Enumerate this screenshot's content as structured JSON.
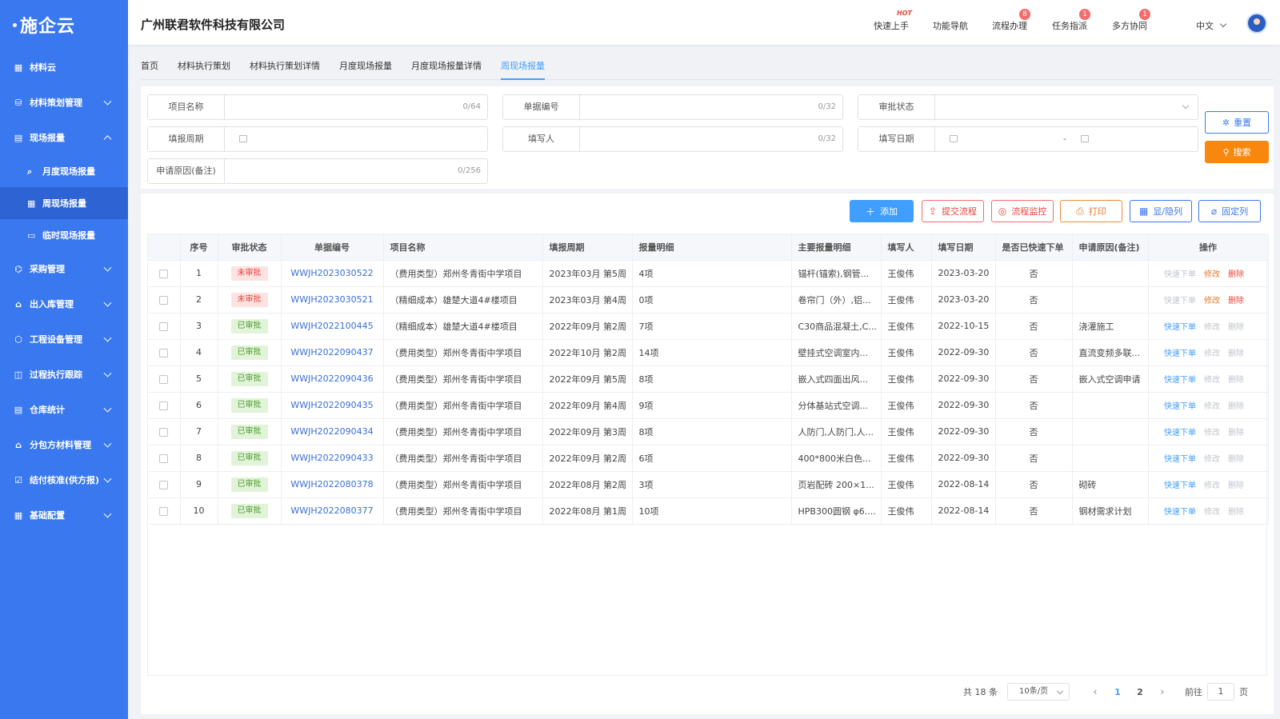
{
  "sidebar": {
    "logo": "施企云",
    "items": [
      {
        "label": "材料云",
        "icon": "grid-icon",
        "expandable": false
      },
      {
        "label": "材料策划管理",
        "icon": "database-icon",
        "expandable": true
      },
      {
        "label": "现场报量",
        "icon": "report-icon",
        "expandable": true,
        "expanded": true,
        "children": [
          {
            "label": "月度现场报量",
            "icon": "doc-search-icon"
          },
          {
            "label": "周现场报量",
            "icon": "calendar-icon",
            "active": true
          },
          {
            "label": "临时现场报量",
            "icon": "id-card-icon"
          }
        ]
      },
      {
        "label": "采购管理",
        "icon": "network-icon",
        "expandable": true
      },
      {
        "label": "出入库管理",
        "icon": "home-icon",
        "expandable": true
      },
      {
        "label": "工程设备管理",
        "icon": "cube-icon",
        "expandable": true
      },
      {
        "label": "过程执行跟踪",
        "icon": "track-icon",
        "expandable": true
      },
      {
        "label": "仓库统计",
        "icon": "stack-icon",
        "expandable": true
      },
      {
        "label": "分包方材料管理",
        "icon": "building-icon",
        "expandable": true
      },
      {
        "label": "结付核准(供方报)",
        "icon": "check-icon",
        "expandable": true
      },
      {
        "label": "基础配置",
        "icon": "apps-icon",
        "expandable": true
      }
    ]
  },
  "header": {
    "company": "广州联君软件科技有限公司",
    "nav": [
      {
        "label": "快速上手",
        "hot": "HOT"
      },
      {
        "label": "功能导航"
      },
      {
        "label": "流程办理",
        "badge": "8"
      },
      {
        "label": "任务指派",
        "badge": "1"
      },
      {
        "label": "多方协同",
        "badge": "1"
      }
    ],
    "lang": "中文"
  },
  "tabs": [
    "首页",
    "材料执行策划",
    "材料执行策划详情",
    "月度现场报量",
    "月度现场报量详情",
    "周现场报量"
  ],
  "active_tab": 5,
  "filters": {
    "project_name": {
      "label": "项目名称",
      "count": "0/64"
    },
    "doc_no": {
      "label": "单据编号",
      "count": "0/32"
    },
    "approval": {
      "label": "审批状态"
    },
    "period": {
      "label": "填报周期"
    },
    "filler": {
      "label": "填写人",
      "count": "0/32"
    },
    "fill_date": {
      "label": "填写日期",
      "sep": "-"
    },
    "reason": {
      "label": "申请原因(备注)",
      "count": "0/256"
    },
    "reset": "重置",
    "search": "搜索"
  },
  "toolbar": {
    "add": "添加",
    "submit": "提交流程",
    "monitor": "流程监控",
    "print": "打印",
    "toggle_cols": "显/隐列",
    "fix_cols": "固定列"
  },
  "table": {
    "headers": [
      "序号",
      "审批状态",
      "单据编号",
      "项目名称",
      "填报周期",
      "报量明细",
      "主要报量明细",
      "填写人",
      "填写日期",
      "是否已快速下单",
      "申请原因(备注)",
      "操作"
    ],
    "ops": {
      "quick": "快速下单",
      "edit": "修改",
      "del": "删除"
    },
    "rows": [
      {
        "no": "1",
        "status": "未审批",
        "approved": false,
        "code": "WWJH2023030522",
        "project": "（费用类型）郑州冬青街中学项目",
        "period": "2023年03月 第5周",
        "detail": "4项",
        "main": "锚杆(锚索),钢管...",
        "filler": "王俊伟",
        "date": "2023-03-20",
        "quick": "否",
        "reason": ""
      },
      {
        "no": "2",
        "status": "未审批",
        "approved": false,
        "code": "WWJH2023030521",
        "project": "（精细成本）雄楚大道4#楼项目",
        "period": "2023年03月 第4周",
        "detail": "0项",
        "main": "卷帘门（外）,铝...",
        "filler": "王俊伟",
        "date": "2023-03-20",
        "quick": "否",
        "reason": ""
      },
      {
        "no": "3",
        "status": "已审批",
        "approved": true,
        "code": "WWJH2022100445",
        "project": "（精细成本）雄楚大道4#楼项目",
        "period": "2022年09月 第2周",
        "detail": "7项",
        "main": "C30商品混凝土,C...",
        "filler": "王俊伟",
        "date": "2022-10-15",
        "quick": "否",
        "reason": "浇灌施工"
      },
      {
        "no": "4",
        "status": "已审批",
        "approved": true,
        "code": "WWJH2022090437",
        "project": "（费用类型）郑州冬青街中学项目",
        "period": "2022年10月 第2周",
        "detail": "14项",
        "main": "壁挂式空调室内...",
        "filler": "王俊伟",
        "date": "2022-09-30",
        "quick": "否",
        "reason": "直流变频多联..."
      },
      {
        "no": "5",
        "status": "已审批",
        "approved": true,
        "code": "WWJH2022090436",
        "project": "（费用类型）郑州冬青街中学项目",
        "period": "2022年09月 第5周",
        "detail": "8项",
        "main": "嵌入式四面出风...",
        "filler": "王俊伟",
        "date": "2022-09-30",
        "quick": "否",
        "reason": "嵌入式空调申请"
      },
      {
        "no": "6",
        "status": "已审批",
        "approved": true,
        "code": "WWJH2022090435",
        "project": "（费用类型）郑州冬青街中学项目",
        "period": "2022年09月 第4周",
        "detail": "9项",
        "main": "分体基站式空调...",
        "filler": "王俊伟",
        "date": "2022-09-30",
        "quick": "否",
        "reason": ""
      },
      {
        "no": "7",
        "status": "已审批",
        "approved": true,
        "code": "WWJH2022090434",
        "project": "（费用类型）郑州冬青街中学项目",
        "period": "2022年09月 第3周",
        "detail": "8项",
        "main": "人防门,人防门,人...",
        "filler": "王俊伟",
        "date": "2022-09-30",
        "quick": "否",
        "reason": ""
      },
      {
        "no": "8",
        "status": "已审批",
        "approved": true,
        "code": "WWJH2022090433",
        "project": "（费用类型）郑州冬青街中学项目",
        "period": "2022年09月 第2周",
        "detail": "6项",
        "main": "400*800米白色...",
        "filler": "王俊伟",
        "date": "2022-09-30",
        "quick": "否",
        "reason": ""
      },
      {
        "no": "9",
        "status": "已审批",
        "approved": true,
        "code": "WWJH2022080378",
        "project": "（费用类型）郑州冬青街中学项目",
        "period": "2022年08月 第2周",
        "detail": "3项",
        "main": "页岩配砖 200×1...",
        "filler": "王俊伟",
        "date": "2022-08-14",
        "quick": "否",
        "reason": "砌砖"
      },
      {
        "no": "10",
        "status": "已审批",
        "approved": true,
        "code": "WWJH2022080377",
        "project": "（费用类型）郑州冬青街中学项目",
        "period": "2022年08月 第1周",
        "detail": "10项",
        "main": "HPB300圆钢 φ6....",
        "filler": "王俊伟",
        "date": "2022-08-14",
        "quick": "否",
        "reason": "钢材需求计划"
      }
    ]
  },
  "pager": {
    "total": "共 18 条",
    "size": "10条/页",
    "pages": [
      "1",
      "2"
    ],
    "current": "1",
    "goto_prefix": "前往",
    "goto_value": "1",
    "goto_suffix": "页"
  },
  "colors": {
    "sidebar": "#3a78ef",
    "accent": "#409eff",
    "danger": "#e8463c",
    "warning": "#f7870d",
    "success": "#4e9b2c"
  }
}
